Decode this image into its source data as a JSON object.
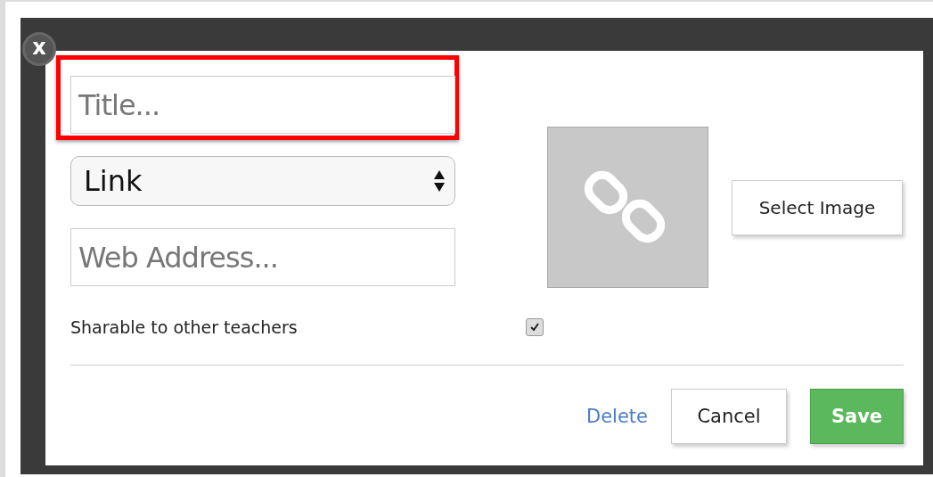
{
  "close_button": {
    "label": "x"
  },
  "title_field": {
    "placeholder": "Title...",
    "highlighted": true
  },
  "type_select": {
    "value": "Link"
  },
  "address_field": {
    "placeholder": "Web Address..."
  },
  "image": {
    "select_button": "Select Image"
  },
  "share_option": {
    "label": "Sharable to other teachers",
    "checked": true
  },
  "buttons": [
    {
      "label": "Delete",
      "kind": "link"
    },
    {
      "label": "Cancel",
      "kind": "default"
    },
    {
      "label": "Save",
      "kind": "primary"
    }
  ]
}
